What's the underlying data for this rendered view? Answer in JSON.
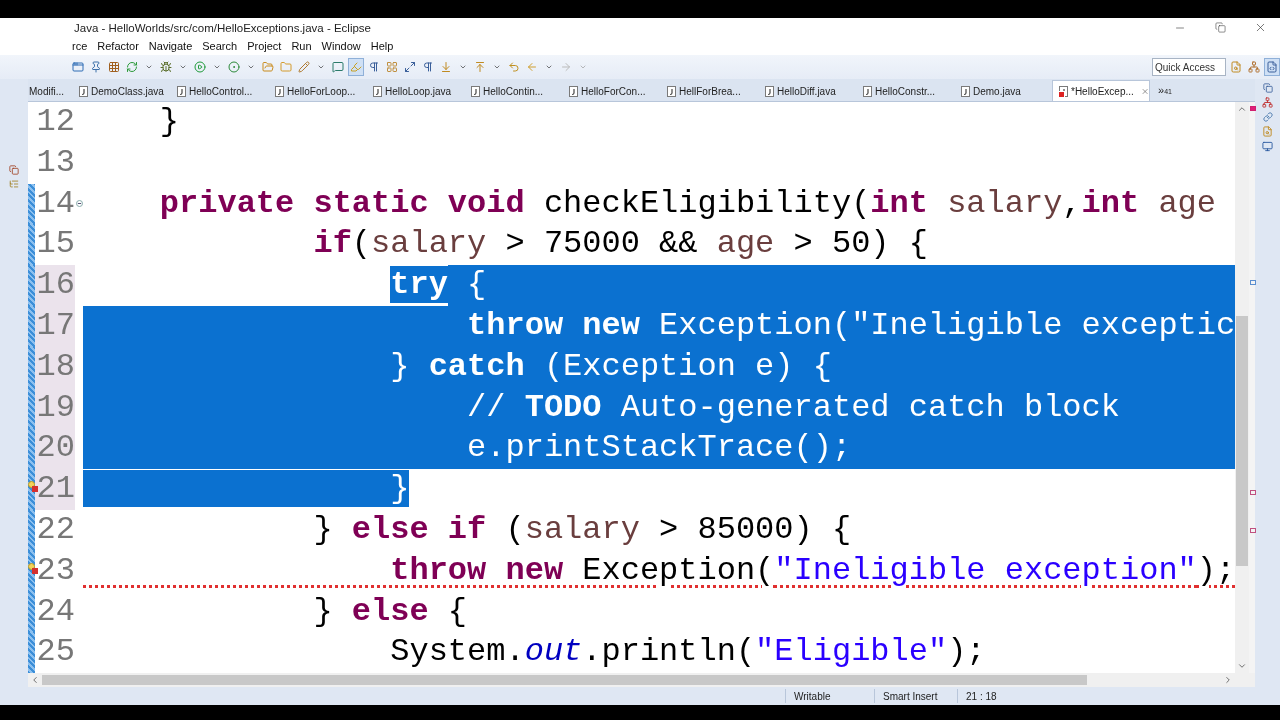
{
  "window": {
    "title": "Java - HelloWorlds/src/com/HelloExceptions.java - Eclipse"
  },
  "menu": [
    "rce",
    "Refactor",
    "Navigate",
    "Search",
    "Project",
    "Run",
    "Window",
    "Help"
  ],
  "quick_access": {
    "placeholder": "Quick Access"
  },
  "tabs": [
    {
      "label": "Modifi...",
      "selected": false
    },
    {
      "label": "DemoClass.java",
      "selected": false,
      "error": false
    },
    {
      "label": "HelloControl...",
      "selected": false,
      "error": false
    },
    {
      "label": "HelloForLoop...",
      "selected": false,
      "error": false
    },
    {
      "label": "HelloLoop.java",
      "selected": false,
      "error": false
    },
    {
      "label": "HelloContin...",
      "selected": false,
      "error": false
    },
    {
      "label": "HelloForCon...",
      "selected": false,
      "error": false
    },
    {
      "label": "HellForBrea...",
      "selected": false,
      "error": false
    },
    {
      "label": "HelloDiff.java",
      "selected": false,
      "error": false
    },
    {
      "label": "HelloConstr...",
      "selected": false,
      "error": false
    },
    {
      "label": "Demo.java",
      "selected": false,
      "error": false
    },
    {
      "label": "*HelloExcep...",
      "selected": true,
      "error": true
    }
  ],
  "tab_overflow": {
    "chevron": "»",
    "count": "41"
  },
  "editor": {
    "lines": [
      {
        "number": "12",
        "changed": false,
        "error": false,
        "foldable": false,
        "selected_eol": false,
        "tokens": [
          {
            "text": "    }",
            "kind": "plain",
            "selected": false
          }
        ]
      },
      {
        "number": "13",
        "changed": false,
        "error": false,
        "foldable": false,
        "selected_eol": false
      },
      {
        "number": "14",
        "changed": true,
        "error": false,
        "foldable": true,
        "selected_eol": false,
        "tokens": [
          {
            "text": "    private static void",
            "kind": "keyword",
            "selected": false
          },
          {
            "text": " checkEligibility(",
            "kind": "plain",
            "selected": false
          },
          {
            "text": "int",
            "kind": "keyword",
            "selected": false
          },
          {
            "text": " salary",
            "kind": "param",
            "selected": false
          },
          {
            "text": ",",
            "kind": "plain",
            "selected": false
          },
          {
            "text": "int",
            "kind": "keyword",
            "selected": false
          },
          {
            "text": " age",
            "kind": "param",
            "selected": false
          }
        ]
      },
      {
        "number": "15",
        "changed": true,
        "error": false,
        "foldable": false,
        "selected_eol": false,
        "tokens": [
          {
            "text": "            if",
            "kind": "keyword",
            "selected": false
          },
          {
            "text": "(",
            "kind": "plain",
            "selected": false
          },
          {
            "text": "salary",
            "kind": "param",
            "selected": false
          },
          {
            "text": " > 75000 && ",
            "kind": "plain",
            "selected": false
          },
          {
            "text": "age",
            "kind": "param",
            "selected": false
          },
          {
            "text": " > 50) {",
            "kind": "plain",
            "selected": false
          }
        ]
      },
      {
        "number": "16",
        "changed": true,
        "error": false,
        "foldable": false,
        "selected_eol": true,
        "indent_selected": false,
        "tokens": [
          {
            "text": "                try",
            "kind": "keyword",
            "selected": true
          },
          {
            "text": " {",
            "kind": "plain",
            "selected": true
          }
        ]
      },
      {
        "number": "17",
        "changed": true,
        "error": false,
        "foldable": false,
        "selected_eol": true,
        "indent_selected": true,
        "tokens": [
          {
            "text": "                    throw new",
            "kind": "keyword",
            "selected": true
          },
          {
            "text": " Exception(",
            "kind": "plain",
            "selected": true
          },
          {
            "text": "\"Ineligible exceptic",
            "kind": "string",
            "selected": true
          }
        ]
      },
      {
        "number": "18",
        "changed": true,
        "error": false,
        "foldable": false,
        "selected_eol": true,
        "indent_selected": true,
        "tokens": [
          {
            "text": "                }",
            "kind": "plain",
            "selected": true
          },
          {
            "text": " catch",
            "kind": "keyword",
            "selected": true
          },
          {
            "text": " (Exception e) {",
            "kind": "plain",
            "selected": true
          }
        ]
      },
      {
        "number": "19",
        "changed": true,
        "error": false,
        "foldable": false,
        "selected_eol": true,
        "indent_selected": true,
        "tokens": [
          {
            "text": "                    // ",
            "kind": "comment",
            "selected": true
          },
          {
            "text": "TODO",
            "kind": "todo",
            "selected": true
          },
          {
            "text": " Auto-generated catch block",
            "kind": "comment",
            "selected": true
          }
        ]
      },
      {
        "number": "20",
        "changed": true,
        "error": false,
        "foldable": false,
        "selected_eol": true,
        "indent_selected": true,
        "tokens": [
          {
            "text": "                    e.printStackTrace();",
            "kind": "plain",
            "selected": true
          }
        ]
      },
      {
        "number": "21",
        "changed": true,
        "error": true,
        "foldable": false,
        "selected_eol": false,
        "indent_selected": true,
        "tokens": [
          {
            "text": "                }",
            "kind": "plain",
            "selected": true
          }
        ]
      },
      {
        "number": "22",
        "changed": true,
        "error": false,
        "foldable": false,
        "selected_eol": false,
        "tokens": [
          {
            "text": "            }",
            "kind": "plain",
            "selected": false
          },
          {
            "text": " else if",
            "kind": "keyword",
            "selected": false
          },
          {
            "text": " (",
            "kind": "plain",
            "selected": false
          },
          {
            "text": "salary",
            "kind": "param",
            "selected": false
          },
          {
            "text": " > 85000) {",
            "kind": "plain",
            "selected": false
          }
        ]
      },
      {
        "number": "23",
        "changed": true,
        "error": true,
        "foldable": false,
        "selected_eol": false,
        "tokens": [
          {
            "text": "                throw new",
            "kind": "keyword",
            "selected": false
          },
          {
            "text": " Exception(",
            "kind": "plain",
            "selected": false
          },
          {
            "text": "\"Ineligible exception\"",
            "kind": "string",
            "selected": false
          },
          {
            "text": ");",
            "kind": "plain",
            "selected": false
          }
        ]
      },
      {
        "number": "24",
        "changed": true,
        "error": false,
        "foldable": false,
        "selected_eol": false,
        "tokens": [
          {
            "text": "            }",
            "kind": "plain",
            "selected": false
          },
          {
            "text": " else",
            "kind": "keyword",
            "selected": false
          },
          {
            "text": " {",
            "kind": "plain",
            "selected": false
          }
        ]
      },
      {
        "number": "25",
        "changed": true,
        "error": false,
        "foldable": false,
        "selected_eol": false,
        "tokens": [
          {
            "text": "                System.",
            "kind": "plain",
            "selected": false
          },
          {
            "text": "out",
            "kind": "field",
            "selected": false
          },
          {
            "text": ".println(",
            "kind": "plain",
            "selected": false
          },
          {
            "text": "\"Eligible\"",
            "kind": "string",
            "selected": false
          },
          {
            "text": ");",
            "kind": "plain",
            "selected": false
          }
        ]
      }
    ]
  },
  "status_bar": {
    "mode": "Writable",
    "insert": "Smart Insert",
    "position": "21 : 18"
  }
}
